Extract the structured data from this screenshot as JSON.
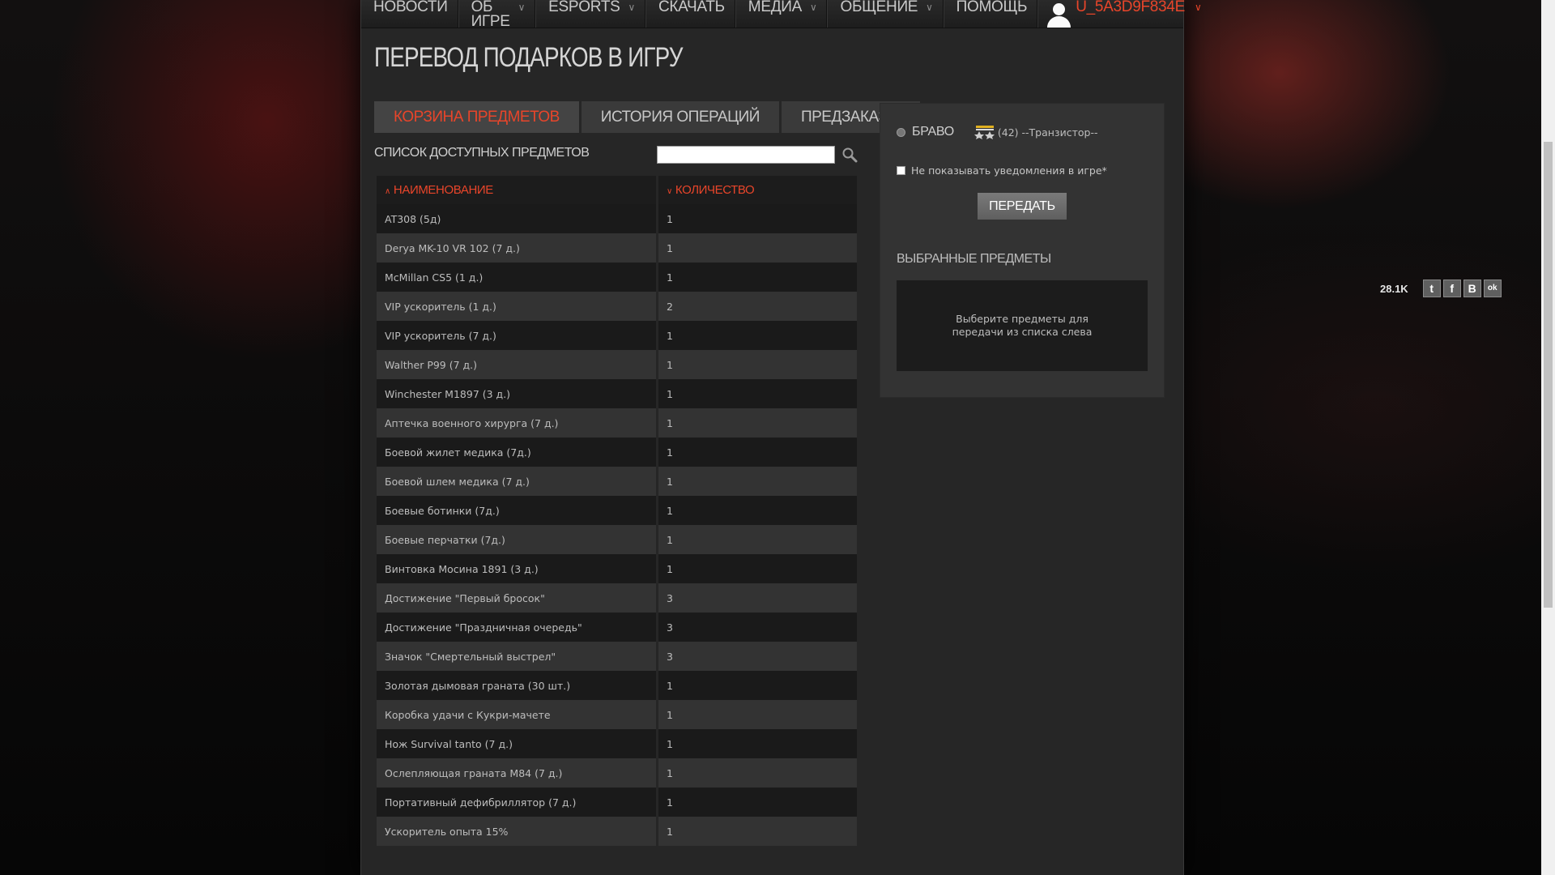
{
  "nav": {
    "items": [
      {
        "label": "Новости",
        "has_dropdown": false
      },
      {
        "label": "Об игре",
        "has_dropdown": true
      },
      {
        "label": "Esports",
        "has_dropdown": true
      },
      {
        "label": "Скачать",
        "has_dropdown": false
      },
      {
        "label": "Медиа",
        "has_dropdown": true
      },
      {
        "label": "Общение",
        "has_dropdown": true
      },
      {
        "label": "Помощь",
        "has_dropdown": false
      }
    ],
    "username": "U_5A3D9F834E"
  },
  "page_title": "Перевод подарков в игру",
  "tabs": [
    {
      "label": "Корзина предметов",
      "active": true
    },
    {
      "label": "История операций",
      "active": false
    },
    {
      "label": "Предзаказы",
      "active": false
    }
  ],
  "list": {
    "title": "Список доступных предметов",
    "search_value": "",
    "columns": {
      "name": "Наименование",
      "quantity": "Количество"
    },
    "items": [
      {
        "name": "AT308 (5д)",
        "qty": "1"
      },
      {
        "name": "Derya MK-10 VR 102 (7 д.)",
        "qty": "1"
      },
      {
        "name": "McMillan CS5 (1 д.)",
        "qty": "1"
      },
      {
        "name": "VIP ускоритель (1 д.)",
        "qty": "2"
      },
      {
        "name": "VIP ускоритель (7 д.)",
        "qty": "1"
      },
      {
        "name": "Walther P99 (7 д.)",
        "qty": "1"
      },
      {
        "name": "Winchester M1897 (3 д.)",
        "qty": "1"
      },
      {
        "name": "Аптечка военного хирурга (7 д.)",
        "qty": "1"
      },
      {
        "name": "Боевой жилет медика (7д.)",
        "qty": "1"
      },
      {
        "name": "Боевой шлем медика (7 д.)",
        "qty": "1"
      },
      {
        "name": "Боевые ботинки (7д.)",
        "qty": "1"
      },
      {
        "name": "Боевые перчатки (7д.)",
        "qty": "1"
      },
      {
        "name": "Винтовка Мосина 1891 (3 д.)",
        "qty": "1"
      },
      {
        "name": "Достижение \"Первый бросок\"",
        "qty": "3"
      },
      {
        "name": "Достижение \"Праздничная очередь\"",
        "qty": "3"
      },
      {
        "name": "Значок \"Смертельный выстрел\"",
        "qty": "3"
      },
      {
        "name": "Золотая дымовая граната (30 шт.)",
        "qty": "1"
      },
      {
        "name": "Коробка удачи с Кукри-мачете",
        "qty": "1"
      },
      {
        "name": "Нож Survival tanto (7 д.)",
        "qty": "1"
      },
      {
        "name": "Ослепляющая граната M84 (7 д.)",
        "qty": "1"
      },
      {
        "name": "Портативный дефибриллятор (7 д.)",
        "qty": "1"
      },
      {
        "name": "Ускоритель опыта 15%",
        "qty": "1"
      }
    ]
  },
  "panel": {
    "server": "Браво",
    "character": "(42) --Транзистор--",
    "notify_label": "Не показывать уведомления в игре*",
    "transfer_button": "Передать",
    "selected_title": "Выбранные предметы",
    "selected_placeholder": "Выберите предметы для передачи из списка слева"
  },
  "share": {
    "count": "28.1K",
    "buttons": [
      {
        "icon": "twitter-icon",
        "glyph": "t"
      },
      {
        "icon": "facebook-icon",
        "glyph": "f"
      },
      {
        "icon": "vk-icon",
        "glyph": "B"
      },
      {
        "icon": "odnoklassniki-icon",
        "glyph": "ok"
      }
    ]
  },
  "colors": {
    "accent": "#e8452a",
    "panel": "#333333",
    "row_dark": "#1a1a1a",
    "row_light": "#333333"
  }
}
